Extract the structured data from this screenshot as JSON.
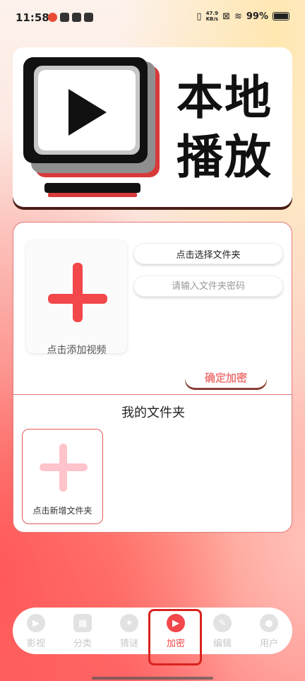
{
  "status_bar": {
    "time": "11:58",
    "speed_value": "47.9",
    "speed_unit": "KB/s",
    "battery": "99%",
    "battery_level": 0.99
  },
  "banner": {
    "line1": "本地",
    "line2": "播放",
    "icon": "tv-play-icon"
  },
  "encrypt": {
    "add_video_label": "点击添加视频",
    "select_folder": "点击选择文件夹",
    "password_placeholder": "请输入文件夹密码",
    "confirm": "确定加密"
  },
  "folders": {
    "title": "我的文件夹",
    "add_folder_label": "点击新增文件夹"
  },
  "nav": {
    "items": [
      {
        "label": "影视",
        "icon": "play-circle-icon"
      },
      {
        "label": "分类",
        "icon": "grid-icon"
      },
      {
        "label": "猜谜",
        "icon": "puzzle-icon"
      },
      {
        "label": "加密",
        "icon": "video-lock-icon"
      },
      {
        "label": "编辑",
        "icon": "edit-icon"
      },
      {
        "label": "用户",
        "icon": "user-icon"
      }
    ],
    "active_index": 3
  },
  "colors": {
    "accent": "#f2474b",
    "card_border": "#e07a7a",
    "frame": "#d9231f"
  }
}
